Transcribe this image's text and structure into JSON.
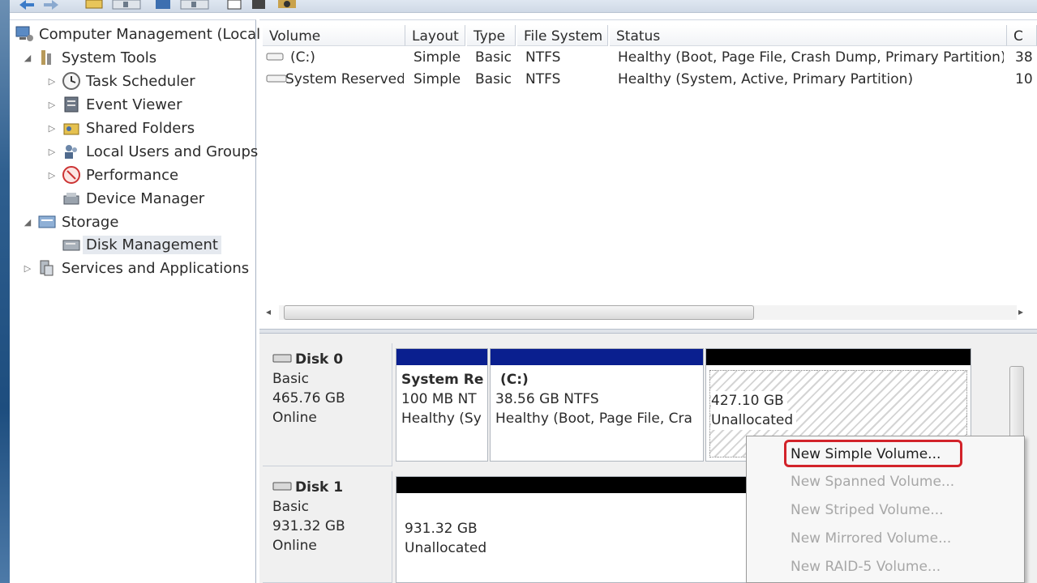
{
  "tree": {
    "root": "Computer Management (Local",
    "items": [
      {
        "label": "System Tools",
        "icon": "toolbox-icon"
      },
      {
        "label": "Task Scheduler",
        "icon": "clock-icon"
      },
      {
        "label": "Event Viewer",
        "icon": "event-viewer-icon"
      },
      {
        "label": "Shared Folders",
        "icon": "shared-folder-icon"
      },
      {
        "label": "Local Users and Groups",
        "icon": "users-icon"
      },
      {
        "label": "Performance",
        "icon": "performance-icon"
      },
      {
        "label": "Device Manager",
        "icon": "device-manager-icon"
      },
      {
        "label": "Storage",
        "icon": "storage-icon"
      },
      {
        "label": "Disk Management",
        "icon": "disk-management-icon"
      },
      {
        "label": "Services and Applications",
        "icon": "services-icon"
      }
    ]
  },
  "volume_list": {
    "headers": [
      "Volume",
      "Layout",
      "Type",
      "File System",
      "Status",
      "C"
    ],
    "rows": [
      {
        "volume": "(C:)",
        "layout": "Simple",
        "type": "Basic",
        "fs": "NTFS",
        "status": "Healthy (Boot, Page File, Crash Dump, Primary Partition)",
        "cap": "38"
      },
      {
        "volume": "System Reserved",
        "layout": "Simple",
        "type": "Basic",
        "fs": "NTFS",
        "status": "Healthy (System, Active, Primary Partition)",
        "cap": "10"
      }
    ]
  },
  "disks": [
    {
      "name": "Disk 0",
      "type": "Basic",
      "size": "465.76 GB",
      "state": "Online",
      "partitions": [
        {
          "title": "System Re",
          "line1": "100 MB NT",
          "line2": "Healthy (Sy"
        },
        {
          "title": "(C:)",
          "line1": "38.56 GB NTFS",
          "line2": "Healthy (Boot, Page File, Cra"
        },
        {
          "title": "",
          "line1": "427.10 GB",
          "line2": "Unallocated"
        }
      ]
    },
    {
      "name": "Disk 1",
      "type": "Basic",
      "size": "931.32 GB",
      "state": "Online",
      "partitions": [
        {
          "title": "",
          "line1": "931.32 GB",
          "line2": "Unallocated"
        }
      ]
    }
  ],
  "context_menu": {
    "items": [
      {
        "label": "New Simple Volume...",
        "enabled": true
      },
      {
        "label": "New Spanned Volume...",
        "enabled": false
      },
      {
        "label": "New Striped Volume...",
        "enabled": false
      },
      {
        "label": "New Mirrored Volume...",
        "enabled": false
      },
      {
        "label": "New RAID-5 Volume...",
        "enabled": false
      }
    ]
  },
  "colors": {
    "primary_partition_bar": "#0a1f8f",
    "unallocated_bar": "#000000",
    "highlight_border": "#d2232a"
  }
}
